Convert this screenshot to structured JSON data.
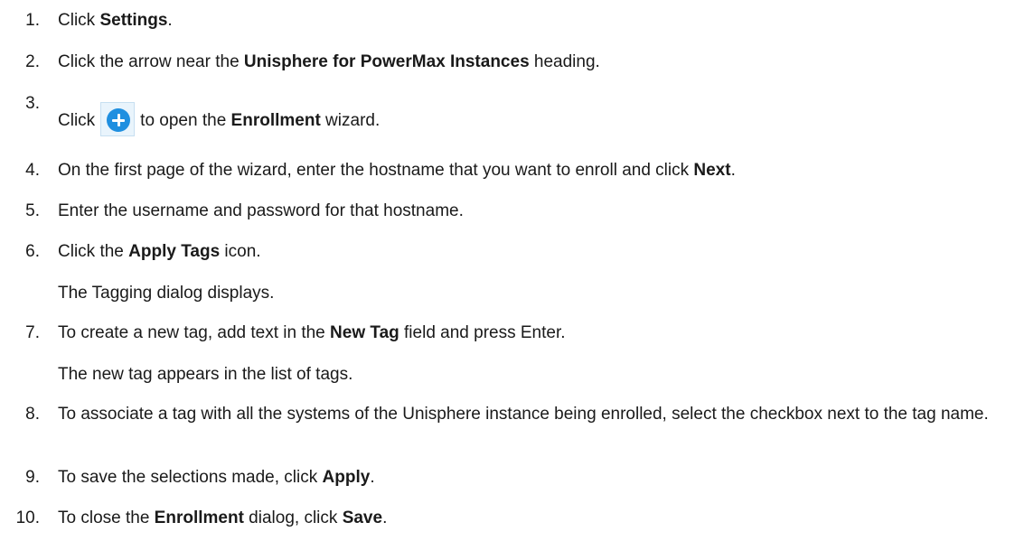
{
  "steps": [
    {
      "num": "1.",
      "parts": [
        [
          "Click ",
          false
        ],
        [
          "Settings",
          true
        ],
        [
          ".",
          false
        ]
      ]
    },
    {
      "num": "2.",
      "parts": [
        [
          "Click the arrow near the ",
          false
        ],
        [
          "Unisphere for PowerMax Instances",
          true
        ],
        [
          " heading.",
          false
        ]
      ]
    },
    {
      "num": "3.",
      "pre": "Click",
      "icon": "add-circle-icon",
      "parts": [
        [
          "to open the ",
          false
        ],
        [
          "Enrollment",
          true
        ],
        [
          " wizard.",
          false
        ]
      ]
    },
    {
      "num": "4.",
      "parts": [
        [
          "On the first page of the wizard, enter the hostname that you want to enroll and click ",
          false
        ],
        [
          "Next",
          true
        ],
        [
          ".",
          false
        ]
      ]
    },
    {
      "num": "5.",
      "parts": [
        [
          "Enter the username and password for that hostname.",
          false
        ]
      ]
    },
    {
      "num": "6.",
      "parts": [
        [
          "Click the ",
          false
        ],
        [
          "Apply Tags",
          true
        ],
        [
          " icon.",
          false
        ]
      ],
      "result": "The Tagging dialog displays."
    },
    {
      "num": "7.",
      "parts": [
        [
          "To create a new tag, add text in the ",
          false
        ],
        [
          "New Tag",
          true
        ],
        [
          " field and press Enter.",
          false
        ]
      ],
      "result": "The new tag appears in the list of tags."
    },
    {
      "num": "8.",
      "parts": [
        [
          "To associate a tag with all the systems of the Unisphere instance being enrolled, select the checkbox next to the tag name.",
          false
        ]
      ]
    },
    {
      "num": "9.",
      "parts": [
        [
          "To save the selections made, click ",
          false
        ],
        [
          "Apply",
          true
        ],
        [
          ".",
          false
        ]
      ]
    },
    {
      "num": "10.",
      "parts": [
        [
          "To close the ",
          false
        ],
        [
          "Enrollment",
          true
        ],
        [
          " dialog, click ",
          false
        ],
        [
          "Save",
          true
        ],
        [
          ".",
          false
        ]
      ]
    }
  ]
}
